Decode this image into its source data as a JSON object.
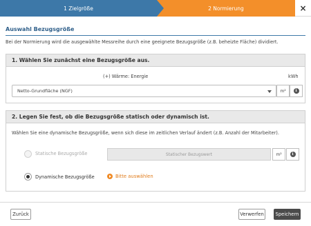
{
  "wizard": {
    "step1_label": "1 Zielgröße",
    "step2_label": "2 Normierung",
    "close_label": "×"
  },
  "page": {
    "title": "Auswahl Bezugsgröße",
    "intro": "Bei der Normierung wird die ausgewählte Messreihe durch eine geeignete Bezugsgröße (z.B. beheizte Fläche) dividiert."
  },
  "section1": {
    "title": "1. Wählen Sie zunächst eine Bezugsgröße aus.",
    "energy_label": "(+) Wärme: Energie",
    "unit": "kWh",
    "select_value": "Netto-Grundfläche (NGF)",
    "select_unit": "m²"
  },
  "section2": {
    "title": "2. Legen Sie fest, ob die Bezugsgröße statisch oder dynamisch ist.",
    "text": "Wählen Sie eine dynamische Bezugsgröße, wenn sich diese im zeitlichen Verlauf ändert (z.B. Anzahl der Mitarbeiter).",
    "static_label": "Statische Bezugsgröße",
    "static_placeholder": "Statischer Bezugswert",
    "static_unit": "m²",
    "dynamic_label": "Dynamische Bezugsgröße",
    "dynamic_action": "Bitte auswählen"
  },
  "footer": {
    "back": "Zurück",
    "discard": "Verwerfen",
    "save": "Speichern"
  },
  "colors": {
    "step1": "#3d78a8",
    "step2": "#f38f2a",
    "accent_text": "#2f5f8a",
    "warn": "#e07b1a"
  },
  "icons": [
    "close-icon",
    "chevron-down-icon",
    "info-icon",
    "play-circle-icon"
  ]
}
